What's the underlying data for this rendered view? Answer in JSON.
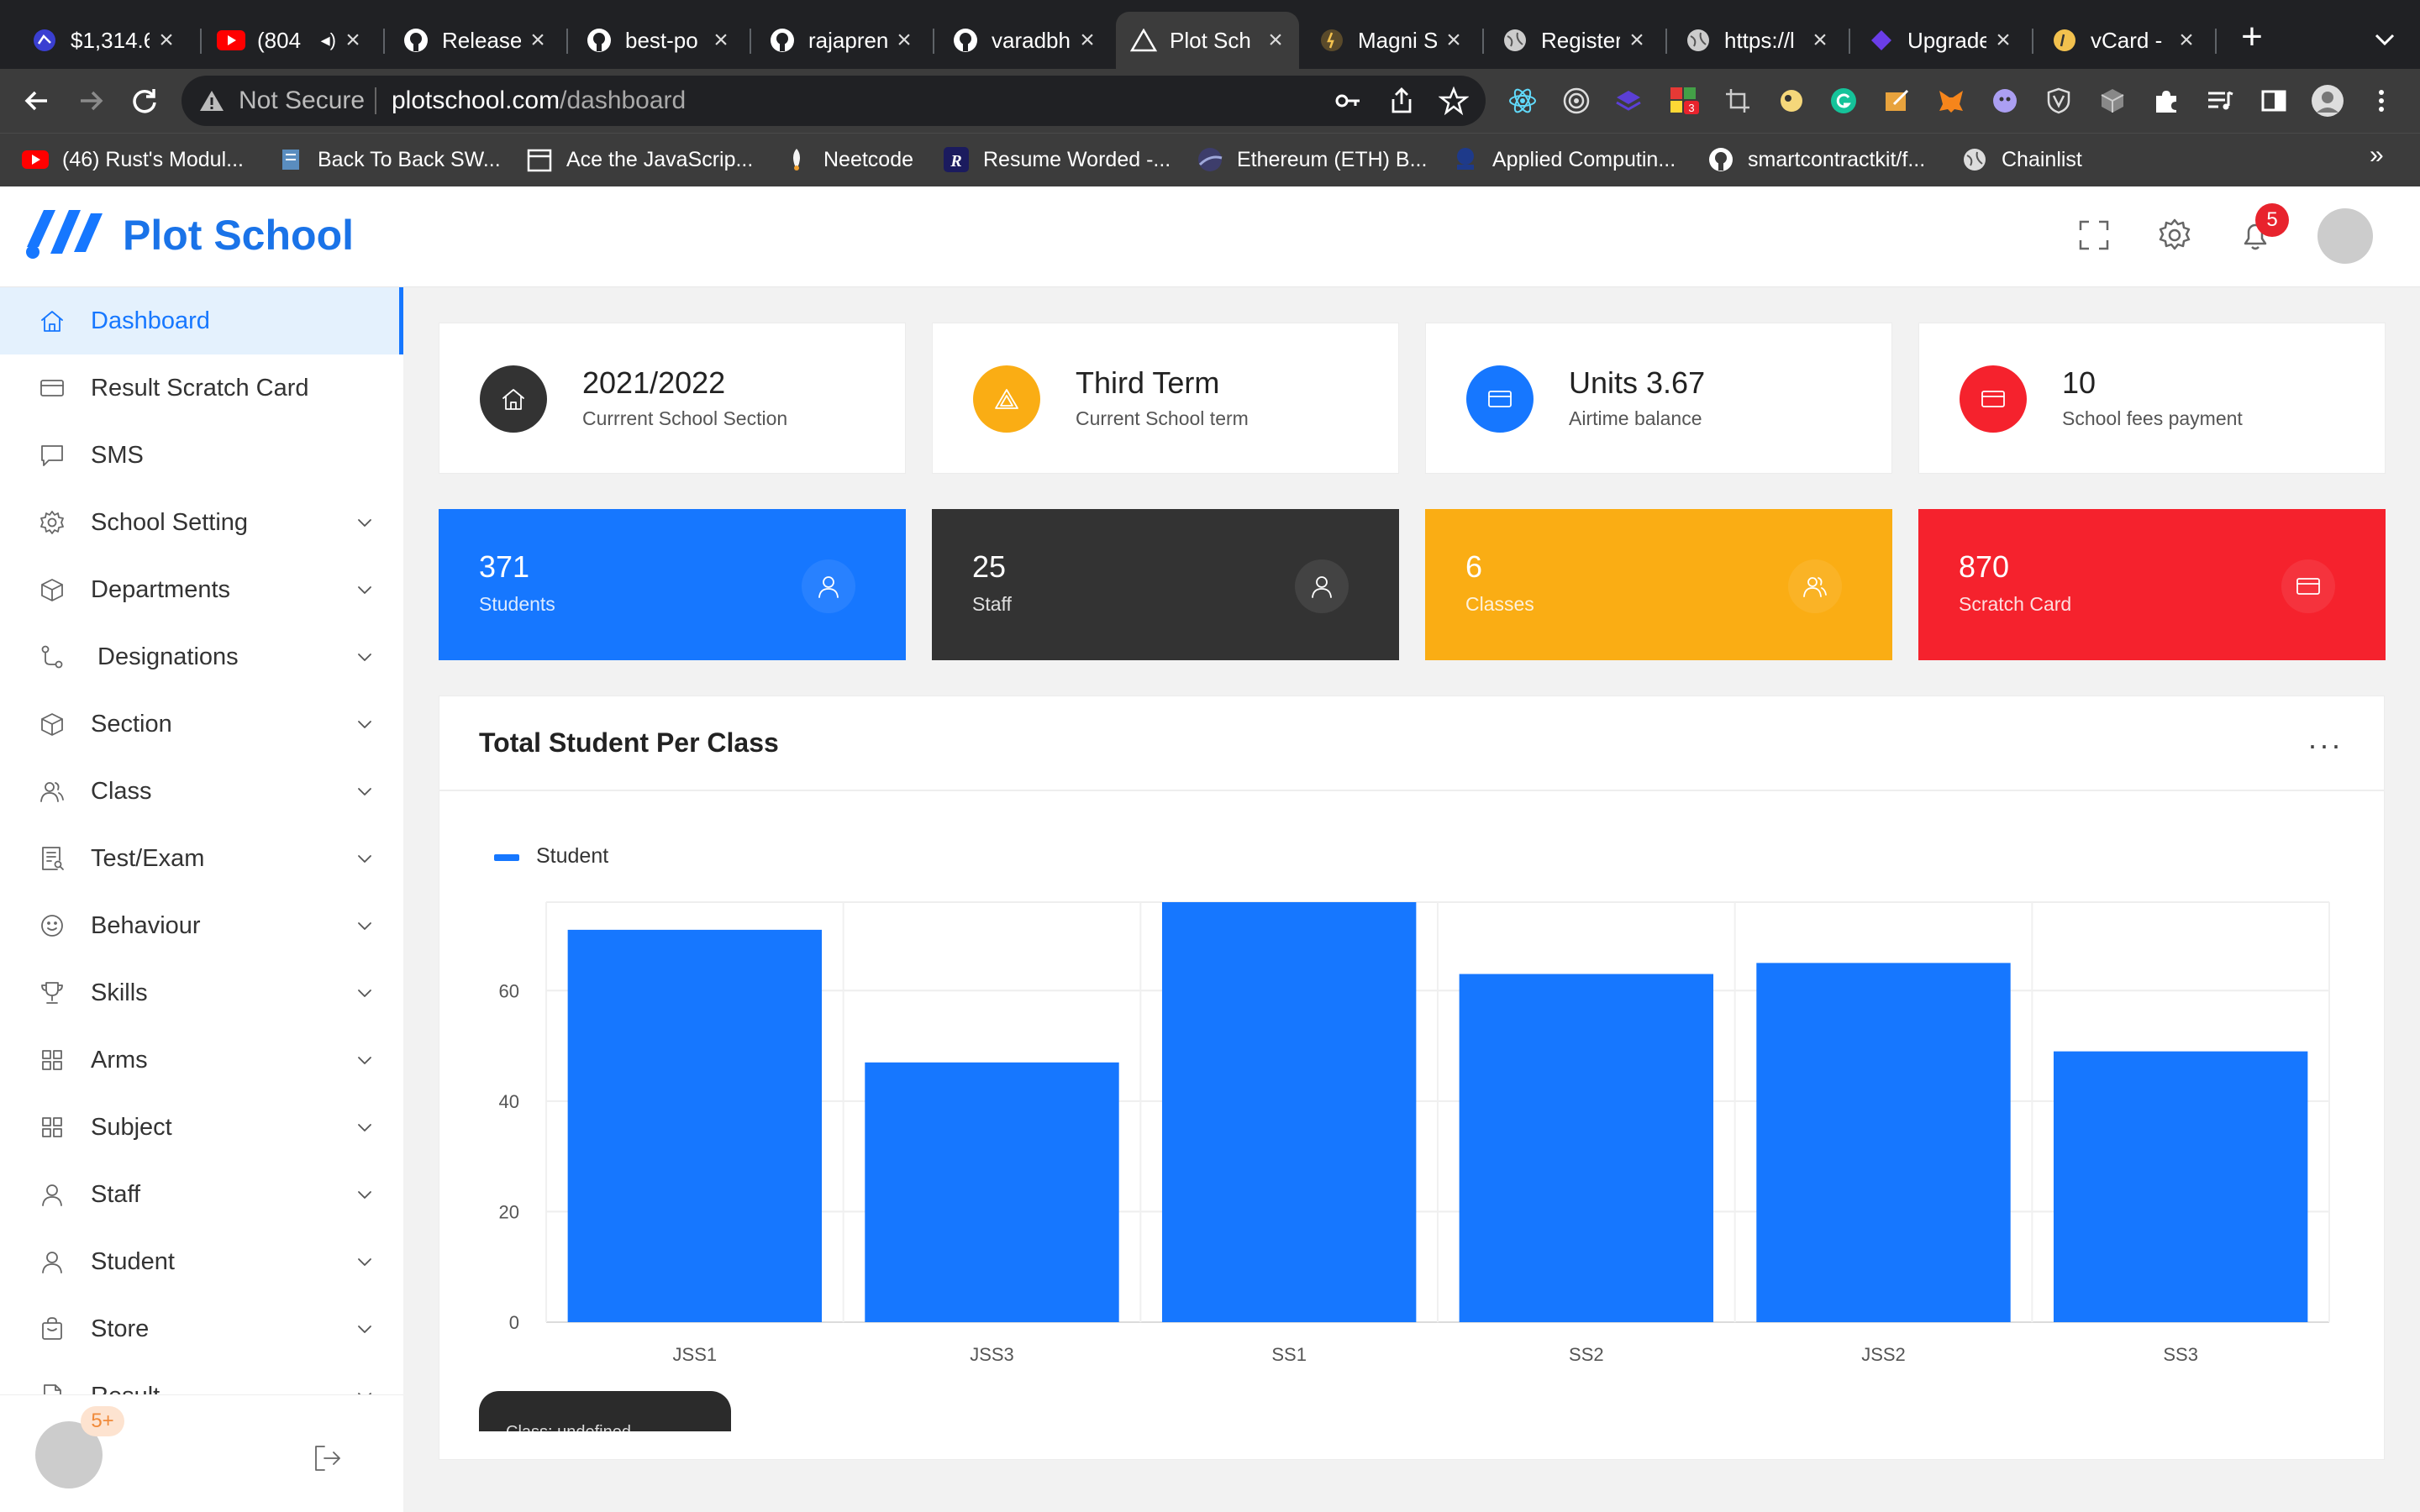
{
  "browser": {
    "tabs": [
      {
        "title": "$1,314.6",
        "icon": "crypto-icon"
      },
      {
        "title": "(804",
        "icon": "youtube-icon"
      },
      {
        "title": "Release",
        "icon": "github-icon"
      },
      {
        "title": "best-po",
        "icon": "github-icon"
      },
      {
        "title": "rajapren",
        "icon": "github-icon"
      },
      {
        "title": "varadbh",
        "icon": "github-icon"
      },
      {
        "title": "Plot Sch",
        "icon": "triangle-icon"
      },
      {
        "title": "Magni S",
        "icon": "magni-icon"
      },
      {
        "title": "Register",
        "icon": "globe-icon"
      },
      {
        "title": "https://l",
        "icon": "globe-icon"
      },
      {
        "title": "Upgrade",
        "icon": "upgrade-icon"
      },
      {
        "title": "vCard -",
        "icon": "vcard-icon"
      }
    ],
    "address": {
      "security": "Not Secure",
      "domain": "plotschool.com",
      "path": "/dashboard"
    },
    "extension_badge": "3",
    "bookmarks": [
      {
        "label": "(46) Rust's Modul...",
        "icon": "youtube-icon"
      },
      {
        "label": "Back To Back SW...",
        "icon": "bookmark-icon"
      },
      {
        "label": "Ace the JavaScrip...",
        "icon": "calendar-icon"
      },
      {
        "label": "Neetcode",
        "icon": "neetcode-icon"
      },
      {
        "label": "Resume Worded -...",
        "icon": "resume-icon"
      },
      {
        "label": "Ethereum (ETH) B...",
        "icon": "ethereum-icon"
      },
      {
        "label": "Applied Computin...",
        "icon": "applied-icon"
      },
      {
        "label": "smartcontractkit/f...",
        "icon": "github-icon"
      },
      {
        "label": "Chainlist",
        "icon": "globe-icon"
      }
    ],
    "bookmarks_more": "»"
  },
  "app": {
    "name": "Plot School",
    "notification_count": "5",
    "sidebar": {
      "items": [
        {
          "label": "Dashboard",
          "icon": "home-icon",
          "active": true,
          "expandable": false
        },
        {
          "label": "Result Scratch Card",
          "icon": "card-icon",
          "active": false,
          "expandable": false
        },
        {
          "label": "SMS",
          "icon": "chat-icon",
          "active": false,
          "expandable": false
        },
        {
          "label": "School Setting",
          "icon": "gear-icon",
          "active": false,
          "expandable": true
        },
        {
          "label": "Departments",
          "icon": "box-icon",
          "active": false,
          "expandable": true
        },
        {
          "label": "Designations",
          "icon": "route-icon",
          "active": false,
          "expandable": true
        },
        {
          "label": "Section",
          "icon": "box-icon",
          "active": false,
          "expandable": true
        },
        {
          "label": "Class",
          "icon": "users-icon",
          "active": false,
          "expandable": true
        },
        {
          "label": "Test/Exam",
          "icon": "exam-icon",
          "active": false,
          "expandable": true
        },
        {
          "label": "Behaviour",
          "icon": "smile-icon",
          "active": false,
          "expandable": true
        },
        {
          "label": "Skills",
          "icon": "trophy-icon",
          "active": false,
          "expandable": true
        },
        {
          "label": "Arms",
          "icon": "grid-icon",
          "active": false,
          "expandable": true
        },
        {
          "label": "Subject",
          "icon": "grid-icon",
          "active": false,
          "expandable": true
        },
        {
          "label": "Staff",
          "icon": "user-icon",
          "active": false,
          "expandable": true
        },
        {
          "label": "Student",
          "icon": "user-icon",
          "active": false,
          "expandable": true
        },
        {
          "label": "Store",
          "icon": "store-icon",
          "active": false,
          "expandable": true
        },
        {
          "label": "Result",
          "icon": "file-icon",
          "active": false,
          "expandable": true
        }
      ],
      "footer_badge": "5+"
    },
    "info_cards": [
      {
        "value": "2021/2022",
        "label": "Currrent School Section",
        "icon": "home-icon",
        "color": "#333333"
      },
      {
        "value": "Third Term",
        "label": "Current School term",
        "icon": "triangle-icon",
        "color": "#faad14"
      },
      {
        "value": "Units 3.67",
        "label": "Airtime balance",
        "icon": "card-icon",
        "color": "#1677ff"
      },
      {
        "value": "10",
        "label": "School fees payment",
        "icon": "card-icon",
        "color": "#f5222d"
      }
    ],
    "stat_cards": [
      {
        "value": "371",
        "label": "Students",
        "icon": "user-icon",
        "color": "#1677ff"
      },
      {
        "value": "25",
        "label": "Staff",
        "icon": "user-icon",
        "color": "#333333"
      },
      {
        "value": "6",
        "label": "Classes",
        "icon": "users-icon",
        "color": "#faad14"
      },
      {
        "value": "870",
        "label": "Scratch Card",
        "icon": "card-icon",
        "color": "#f5222d"
      }
    ],
    "chart_panel": {
      "title": "Total Student Per Class",
      "more": "···",
      "tooltip_text": "Class: undefined"
    }
  },
  "chart_data": {
    "type": "bar",
    "title": "Total Student Per Class",
    "categories": [
      "JSS1",
      "JSS3",
      "SS1",
      "SS2",
      "JSS2",
      "SS3"
    ],
    "series": [
      {
        "name": "Student",
        "values": [
          71,
          47,
          76,
          63,
          65,
          49
        ],
        "color": "#1677ff"
      }
    ],
    "ylim": [
      0,
      76
    ],
    "yticks": [
      0,
      20,
      40,
      60
    ],
    "xlabel": "",
    "ylabel": "",
    "grid": true,
    "legend": "top-left"
  }
}
